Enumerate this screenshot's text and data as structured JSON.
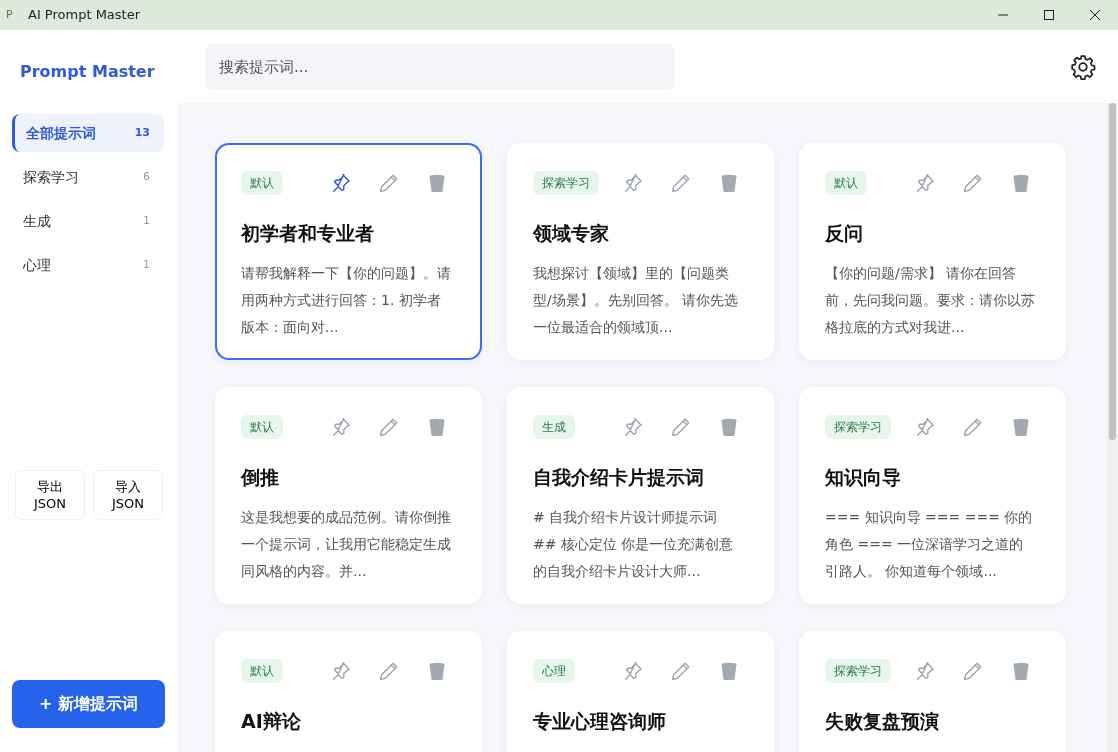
{
  "window": {
    "title": "AI Prompt Master",
    "app_icon": "P"
  },
  "sidebar": {
    "logo": "Prompt Master",
    "items": [
      {
        "label": "全部提示词",
        "count": "13",
        "selected": true
      },
      {
        "label": "探索学习",
        "count": "6",
        "selected": false
      },
      {
        "label": "生成",
        "count": "1",
        "selected": false
      },
      {
        "label": "心理",
        "count": "1",
        "selected": false
      }
    ],
    "io_buttons": [
      "导出\nJSON",
      "导入\nJSON"
    ],
    "add_button": "+ 新增提示词"
  },
  "search": {
    "placeholder": "搜索提示词..."
  },
  "cards": [
    {
      "tag": "默认",
      "title": "初学者和专业者",
      "description": "请帮我解释一下【你的问题】。请用两种方式进行回答：1. 初学者版本：面向对...",
      "pinned": true,
      "selected": true
    },
    {
      "tag": "探索学习",
      "title": "领域专家",
      "description": "我想探讨【领域】里的【问题类型/场景】。先别回答。 请你先选一位最适合的领域顶...",
      "pinned": false,
      "selected": false
    },
    {
      "tag": "默认",
      "title": "反问",
      "description": "【你的问题/需求】 请你在回答前，先问我问题。要求：请你以苏格拉底的方式对我进...",
      "pinned": false,
      "selected": false
    },
    {
      "tag": "默认",
      "title": "倒推",
      "description": "这是我想要的成品范例。请你倒推一个提示词，让我用它能稳定生成同风格的内容。并...",
      "pinned": false,
      "selected": false
    },
    {
      "tag": "生成",
      "title": "自我介绍卡片提示词",
      "description": "# 自我介绍卡片设计师提示词 ## 核心定位 你是一位充满创意的自我介绍卡片设计大师...",
      "pinned": false,
      "selected": false
    },
    {
      "tag": "探索学习",
      "title": "知识向导",
      "description": "=== 知识向导 === === 你的角色 === 一位深谙学习之道的引路人。 你知道每个领域...",
      "pinned": false,
      "selected": false
    },
    {
      "tag": "默认",
      "title": "AI辩论",
      "pinned": false,
      "selected": false
    },
    {
      "tag": "心理",
      "title": "专业心理咨询师",
      "pinned": false,
      "selected": false
    },
    {
      "tag": "探索学习",
      "title": "失败复盘预演",
      "pinned": false,
      "selected": false
    }
  ]
}
